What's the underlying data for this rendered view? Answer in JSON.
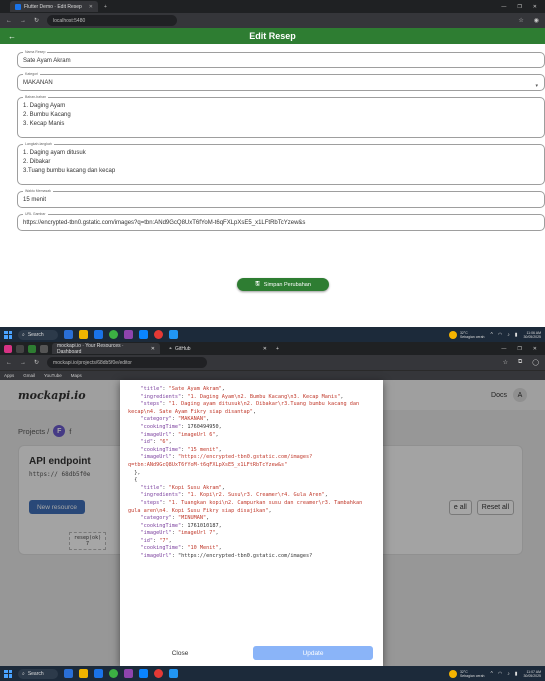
{
  "window_top": {
    "tab_title": "Flutter Demo · Edit Resep",
    "url": "localhost:5480",
    "appbar_title": "Edit Resep",
    "fields": [
      {
        "label": "Nama Resep",
        "value": "Sate Ayam Akram"
      },
      {
        "label": "Kategori",
        "value": "MAKANAN"
      },
      {
        "label": "Bahan-bahan",
        "value": "1. Daging Ayam\n2. Bumbu Kacang\n3. Kecap Manis"
      },
      {
        "label": "Langkah-langkah",
        "value": "1. Daging ayam ditusuk\n2. Dibakar\n3.Tuang bumbu kacang dan kecap"
      },
      {
        "label": "Waktu Memasak",
        "value": "15 menit"
      },
      {
        "label": "URL Gambar",
        "value": "https://encrypted-tbn0.gstatic.com/images?q=tbn:ANd9GcQ8UxT6fYoM-t6qFXLpXsE5_x1LFtRbTcYzew&s"
      }
    ],
    "save_label": "Simpan Perubahan",
    "taskbar": {
      "search": "Search",
      "weather_temp": "32°C",
      "weather_desc": "Sebagian cerah",
      "time": "11:06 AM",
      "date": "30/05/2025"
    }
  },
  "window_bottom": {
    "tab_title": "mockapi.io · Your Resources · Dashboard",
    "tab2_title": "GitHub",
    "url": "mockapi.io/projects/68db5f0e/editor",
    "bookmarks": [
      "Apps",
      "Gmail",
      "YouTube",
      "Maps"
    ],
    "logo": "mockapi.io",
    "user_name": "Docs",
    "avatar_letter": "A",
    "breadcrumb_projects": "Projects /",
    "project_letter": "F",
    "project_initial": "f",
    "api_title": "API endpoint",
    "api_endpoint": "https:// 68db5f0e",
    "new_resource": "New resource",
    "generate_all": "e all",
    "reset_all": "Reset all",
    "resource_node": "resep(ok)",
    "resource_count": "7",
    "modal_json": "    \"title\": \"Sate Ayam Akram\",\n    \"ingredients\": \"1. Daging Ayam\\n2. Bumbu Kacang\\n3. Kecap Manis\",\n    \"steps\": \"1. Daging ayam ditusuk\\n2. Dibakar\\r3.Tuang bumbu kacang dan kecap\\n4. Sate Ayam Fikry siap disantap\",\n    \"category\": \"MAKANAN\",\n    \"cookingTime\": 1760494950,\n    \"imageUrl\": \"imageUrl 6\",\n    \"id\": \"6\",\n    \"cookingTime\": \"15 menit\",\n    \"imageUrl\": \"https://encrypted-tbn0.gstatic.com/images?q=tbn:ANd9GcQ8UxT6fYoM-t6qFXLpXsE5_x1LFtRbTcYzew&s\"\n  },\n  {\n    \"title\": \"Kopi Susu Akram\",\n    \"ingredients\": \"1. Kopi\\r2. Susu\\r3. Creamer\\r4. Gula Aren\",\n    \"steps\": \"1. Tuangkan kopi\\n2. Campurkan susu dan creamer\\r3. Tambahkan gula aren\\n4. Kopi Susu Fikry siap disajikan\",\n    \"category\": \"MINUMAN\",\n    \"cookingTime\": 1761010187,\n    \"imageUrl\": \"imageUrl 7\",\n    \"id\": \"7\",\n    \"cookingTime\": \"10 Menit\",\n    \"imageUrl\": \"https://encrypted-tbn0.gstatic.com/images?",
    "close_label": "Close",
    "update_label": "Update",
    "taskbar": {
      "search": "Search",
      "weather_temp": "32°C",
      "weather_desc": "Sebagian cerah",
      "time": "11:07 AM",
      "date": "30/05/2025"
    }
  }
}
